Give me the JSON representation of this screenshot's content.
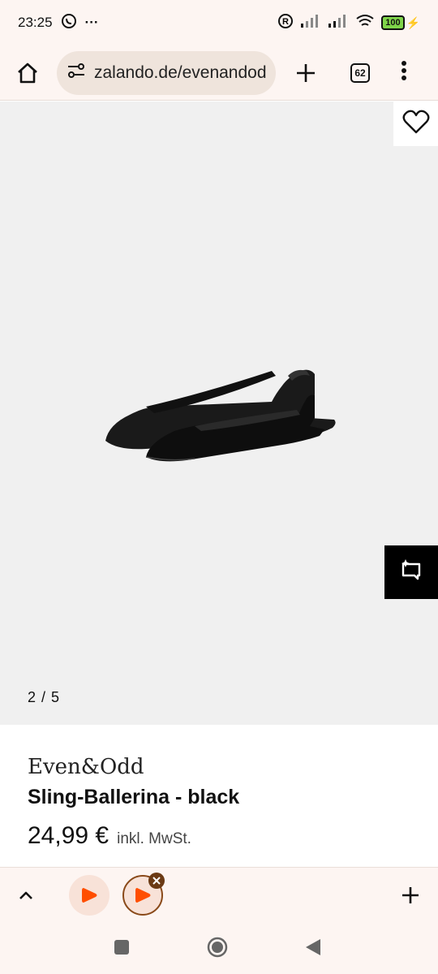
{
  "status": {
    "time": "23:25",
    "dots": "···",
    "battery": "100"
  },
  "browser": {
    "url": "zalando.de/evenandodd",
    "tab_count": "62"
  },
  "gallery": {
    "counter": "2 / 5"
  },
  "product": {
    "brand": "Even&Odd",
    "title": "Sling-Ballerina - black",
    "price": "24,99 €",
    "vat_note": "inkl. MwSt."
  },
  "colors": {
    "accent": "#ff6900",
    "chrome_bg": "#fdf5f2",
    "image_bg": "#f0f0f0"
  }
}
